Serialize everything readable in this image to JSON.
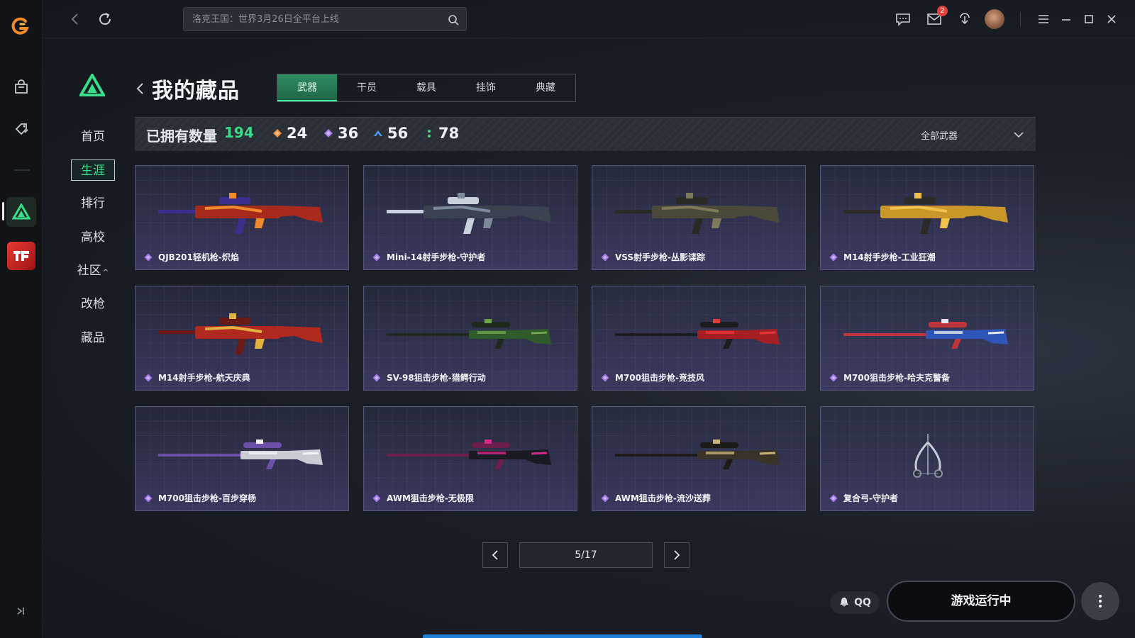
{
  "search": {
    "placeholder": "洛克王国：世界3月26日全平台上线"
  },
  "topbar": {
    "mail_badge": "2"
  },
  "subnav": {
    "items": [
      {
        "label": "首页"
      },
      {
        "label": "生涯"
      },
      {
        "label": "排行"
      },
      {
        "label": "高校"
      },
      {
        "label": "社区"
      },
      {
        "label": "改枪"
      },
      {
        "label": "藏品"
      }
    ],
    "active": "生涯"
  },
  "page": {
    "title": "我的藏品"
  },
  "tabs": [
    {
      "label": "武器"
    },
    {
      "label": "干员"
    },
    {
      "label": "载具"
    },
    {
      "label": "挂饰"
    },
    {
      "label": "典藏"
    }
  ],
  "stats": {
    "owned_label": "已拥有数量",
    "owned_count": "194",
    "rarities": [
      {
        "count": "24",
        "color": "#e8953f"
      },
      {
        "count": "36",
        "color": "#a77cf0"
      },
      {
        "count": "56",
        "color": "#4e9cf2"
      },
      {
        "count": "78",
        "color": "#3bdc86"
      }
    ],
    "filter_label": "全部武器"
  },
  "items": [
    {
      "name": "QJB201轻机枪-炽焰",
      "icon": "rifle-icon",
      "palette": [
        "#a82a1c",
        "#f08a2a",
        "#3a2f8c"
      ]
    },
    {
      "name": "Mini-14射手步枪-守护者",
      "icon": "rifle-icon",
      "palette": [
        "#3b4350",
        "#7e8a99",
        "#c9d2dc"
      ]
    },
    {
      "name": "VSS射手步枪-丛影谍踪",
      "icon": "rifle-icon",
      "palette": [
        "#4b4a3a",
        "#7c7a5a",
        "#2a2a24"
      ]
    },
    {
      "name": "M14射手步枪-工业狂潮",
      "icon": "rifle-icon",
      "palette": [
        "#c9962a",
        "#f0c24a",
        "#2b2a28"
      ]
    },
    {
      "name": "M14射手步枪-航天庆典",
      "icon": "rifle-icon",
      "palette": [
        "#b0281e",
        "#e0b240",
        "#6a1a14"
      ]
    },
    {
      "name": "SV-98狙击步枪-猎鳄行动",
      "icon": "sniper-icon",
      "palette": [
        "#2f5a2a",
        "#6ea44a",
        "#1e2a1c"
      ]
    },
    {
      "name": "M700狙击步枪-竞技风",
      "icon": "sniper-icon",
      "palette": [
        "#a71e22",
        "#e23a3a",
        "#1c1c20"
      ]
    },
    {
      "name": "M700狙击步枪-哈夫克警备",
      "icon": "sniper-icon",
      "palette": [
        "#2d56b8",
        "#e3e6ec",
        "#c2343c"
      ]
    },
    {
      "name": "M700狙击步枪-百步穿杨",
      "icon": "sniper-icon",
      "palette": [
        "#c9ccd4",
        "#f2f3f6",
        "#6d4fa8"
      ]
    },
    {
      "name": "AWM狙击步枪-无极限",
      "icon": "sniper-icon",
      "palette": [
        "#1a1a22",
        "#d52a8a",
        "#6b1f4a"
      ]
    },
    {
      "name": "AWM狙击步枪-流沙送葬",
      "icon": "sniper-icon",
      "palette": [
        "#3a3428",
        "#c8b27a",
        "#1d1b16"
      ]
    },
    {
      "name": "复合弓-守护者",
      "icon": "bow-icon",
      "palette": [
        "#8a93a3",
        "#2b2f38",
        "#c5ccd6"
      ]
    }
  ],
  "item_rarity_color": "#a77cf0",
  "pagination": {
    "current": "5/17"
  },
  "footer": {
    "qq_label": "QQ",
    "play_label": "游戏运行中"
  },
  "colors": {
    "accent": "#36e08a",
    "badge": "#e5413a"
  }
}
